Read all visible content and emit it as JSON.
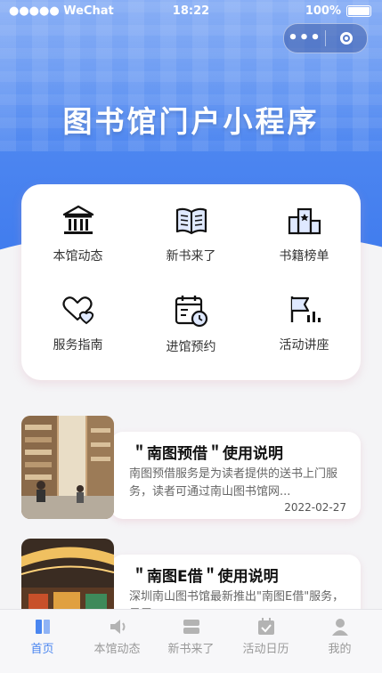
{
  "status_bar": {
    "carrier": "●●●●● WeChat",
    "time": "18:22",
    "battery": "100%"
  },
  "capsule": {
    "more_label": "•••"
  },
  "hero": {
    "title": "图书馆门户小程序"
  },
  "menu": {
    "items": [
      {
        "label": "本馆动态",
        "icon": "bank-icon"
      },
      {
        "label": "新书来了",
        "icon": "open-book-icon"
      },
      {
        "label": "书籍榜单",
        "icon": "podium-icon"
      },
      {
        "label": "服务指南",
        "icon": "hand-heart-icon"
      },
      {
        "label": "进馆预约",
        "icon": "calendar-clock-icon"
      },
      {
        "label": "活动讲座",
        "icon": "flag-icon"
      }
    ]
  },
  "articles": [
    {
      "title": "＂南图预借＂使用说明",
      "desc": "南图预借服务是为读者提供的送书上门服务，读者可通过南山图书馆网...",
      "date": "2022-02-27"
    },
    {
      "title": "＂南图E借＂使用说明",
      "desc": "深圳南山图书馆最新推出\"南图E借\"服务，是零",
      "date": ""
    }
  ],
  "tabbar": {
    "active": "首页",
    "items": [
      {
        "label": "首页",
        "icon": "book-icon"
      },
      {
        "label": "本馆动态",
        "icon": "speaker-icon"
      },
      {
        "label": "新书来了",
        "icon": "books-stack-icon"
      },
      {
        "label": "活动日历",
        "icon": "calendar-check-icon"
      },
      {
        "label": "我的",
        "icon": "user-icon"
      }
    ]
  },
  "colors": {
    "accent": "#4a86f0",
    "tab_inactive": "#999999"
  }
}
